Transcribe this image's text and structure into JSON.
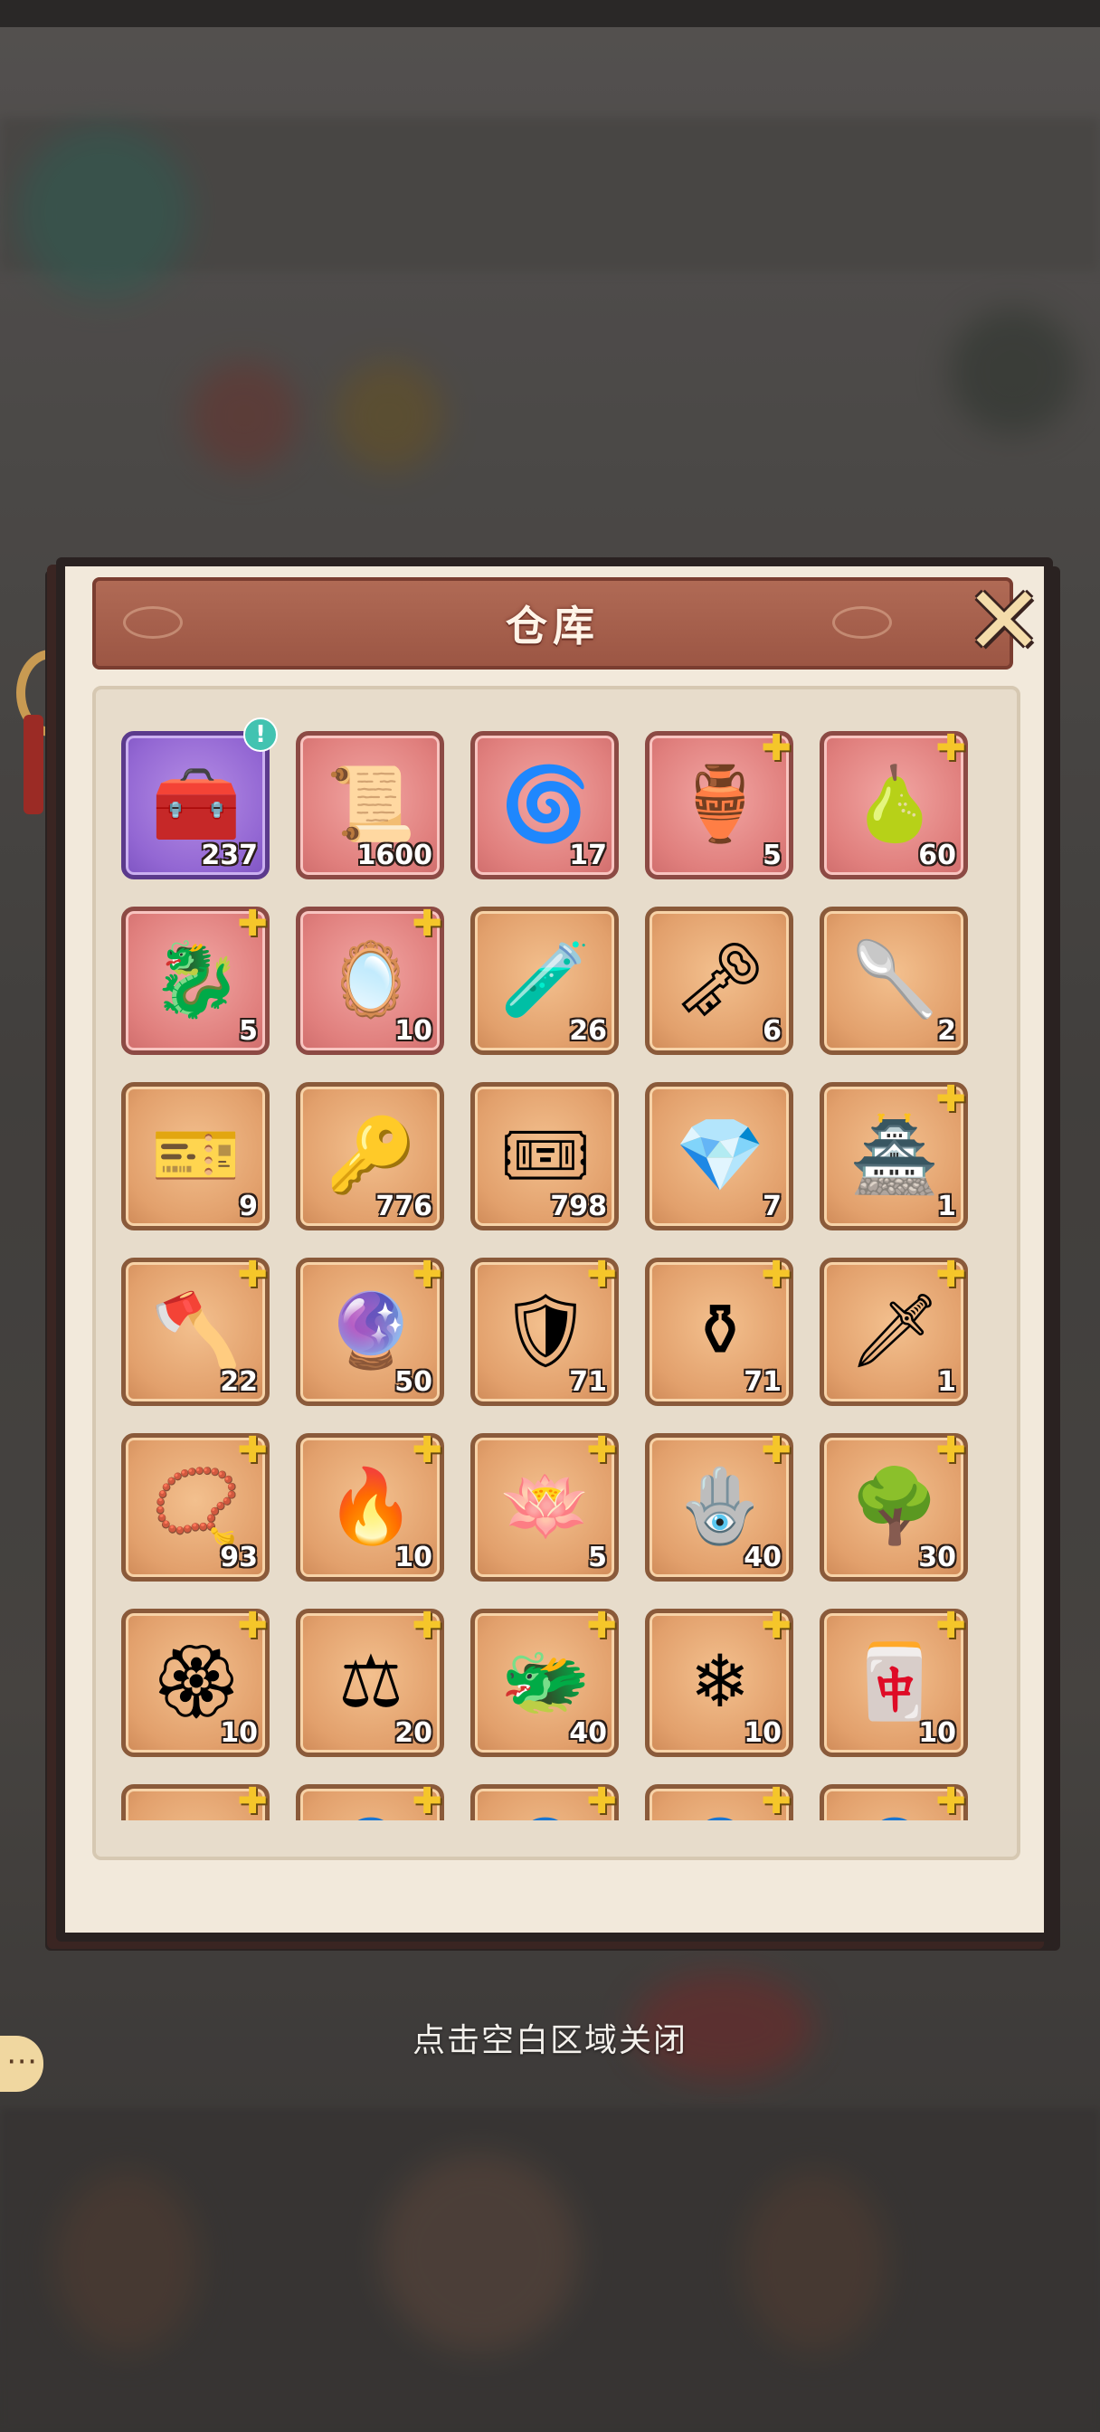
{
  "window": {
    "title": "仓库"
  },
  "close_label": "✕",
  "hint_text": "点击空白区域关闭",
  "items": [
    {
      "icon": "treasure-chest-icon",
      "glyph": "🧰",
      "count": "237",
      "rarity": "purple",
      "puzzle": false,
      "alert": "!"
    },
    {
      "icon": "scroll-icon",
      "glyph": "📜",
      "count": "1600",
      "rarity": "pink",
      "puzzle": false
    },
    {
      "icon": "swirl-orb-icon",
      "glyph": "🌀",
      "count": "17",
      "rarity": "pink",
      "puzzle": false
    },
    {
      "icon": "bronze-cauldron-icon",
      "glyph": "🏺",
      "count": "5",
      "rarity": "pink",
      "puzzle": true
    },
    {
      "icon": "gourd-icon",
      "glyph": "🍐",
      "count": "60",
      "rarity": "pink",
      "puzzle": true
    },
    {
      "icon": "water-dragon-icon",
      "glyph": "🐉",
      "count": "5",
      "rarity": "pink",
      "puzzle": true
    },
    {
      "icon": "mirror-icon",
      "glyph": "🪞",
      "count": "10",
      "rarity": "pink",
      "puzzle": true
    },
    {
      "icon": "potion-icon",
      "glyph": "🧪",
      "count": "26",
      "rarity": "gold",
      "puzzle": false
    },
    {
      "icon": "golden-key-icon",
      "glyph": "🗝",
      "count": "6",
      "rarity": "gold",
      "puzzle": false
    },
    {
      "icon": "spoon-icon",
      "glyph": "🥄",
      "count": "2",
      "rarity": "gold",
      "puzzle": false
    },
    {
      "icon": "red-ticket-icon",
      "glyph": "🎫",
      "count": "9",
      "rarity": "gold",
      "puzzle": false
    },
    {
      "icon": "bronze-key-icon",
      "glyph": "🔑",
      "count": "776",
      "rarity": "gold",
      "puzzle": false
    },
    {
      "icon": "gold-ticket-icon",
      "glyph": "🎟",
      "count": "798",
      "rarity": "gold",
      "puzzle": false
    },
    {
      "icon": "rainbow-gem-icon",
      "glyph": "💎",
      "count": "7",
      "rarity": "gold",
      "puzzle": false
    },
    {
      "icon": "pagoda-icon",
      "glyph": "🏯",
      "count": "1",
      "rarity": "gold",
      "puzzle": true
    },
    {
      "icon": "golden-axe-icon",
      "glyph": "🪓",
      "count": "22",
      "rarity": "gold",
      "puzzle": true
    },
    {
      "icon": "blue-orb-icon",
      "glyph": "🔮",
      "count": "50",
      "rarity": "gold",
      "puzzle": true
    },
    {
      "icon": "flame-shield-icon",
      "glyph": "🛡",
      "count": "71",
      "rarity": "gold",
      "puzzle": true
    },
    {
      "icon": "ding-vessel-icon",
      "glyph": "⚱",
      "count": "71",
      "rarity": "gold",
      "puzzle": true
    },
    {
      "icon": "sword-icon",
      "glyph": "🗡",
      "count": "1",
      "rarity": "gold",
      "puzzle": true
    },
    {
      "icon": "purple-amulet-icon",
      "glyph": "📿",
      "count": "93",
      "rarity": "gold",
      "puzzle": true
    },
    {
      "icon": "fire-brazier-icon",
      "glyph": "🔥",
      "count": "10",
      "rarity": "gold",
      "puzzle": true
    },
    {
      "icon": "white-lotus-icon",
      "glyph": "🪷",
      "count": "5",
      "rarity": "gold",
      "puzzle": true
    },
    {
      "icon": "silver-mirror-icon",
      "glyph": "🪬",
      "count": "40",
      "rarity": "gold",
      "puzzle": true
    },
    {
      "icon": "coral-tree-icon",
      "glyph": "🌳",
      "count": "30",
      "rarity": "gold",
      "puzzle": true
    },
    {
      "icon": "jeweled-ornament-icon",
      "glyph": "🏵",
      "count": "10",
      "rarity": "gold",
      "puzzle": true
    },
    {
      "icon": "balance-scale-icon",
      "glyph": "⚖",
      "count": "20",
      "rarity": "gold",
      "puzzle": true
    },
    {
      "icon": "green-dragon-token-icon",
      "glyph": "🐲",
      "count": "40",
      "rarity": "gold",
      "puzzle": true
    },
    {
      "icon": "blue-dragon-token-icon",
      "glyph": "❄",
      "count": "10",
      "rarity": "gold",
      "puzzle": true
    },
    {
      "icon": "red-dragon-token-icon",
      "glyph": "🀄",
      "count": "10",
      "rarity": "gold",
      "puzzle": true
    },
    {
      "icon": "dragon-token-icon",
      "glyph": "🐲",
      "count": "",
      "rarity": "gold",
      "puzzle": true
    },
    {
      "icon": "portrait-dark-icon",
      "glyph": "👤",
      "count": "",
      "rarity": "gold",
      "puzzle": true
    },
    {
      "icon": "portrait-white-hair-icon",
      "glyph": "👤",
      "count": "",
      "rarity": "gold",
      "puzzle": true
    },
    {
      "icon": "portrait-green-hair-icon",
      "glyph": "👤",
      "count": "",
      "rarity": "gold",
      "puzzle": true
    },
    {
      "icon": "portrait-warrior-icon",
      "glyph": "👤",
      "count": "",
      "rarity": "gold",
      "puzzle": true
    }
  ]
}
